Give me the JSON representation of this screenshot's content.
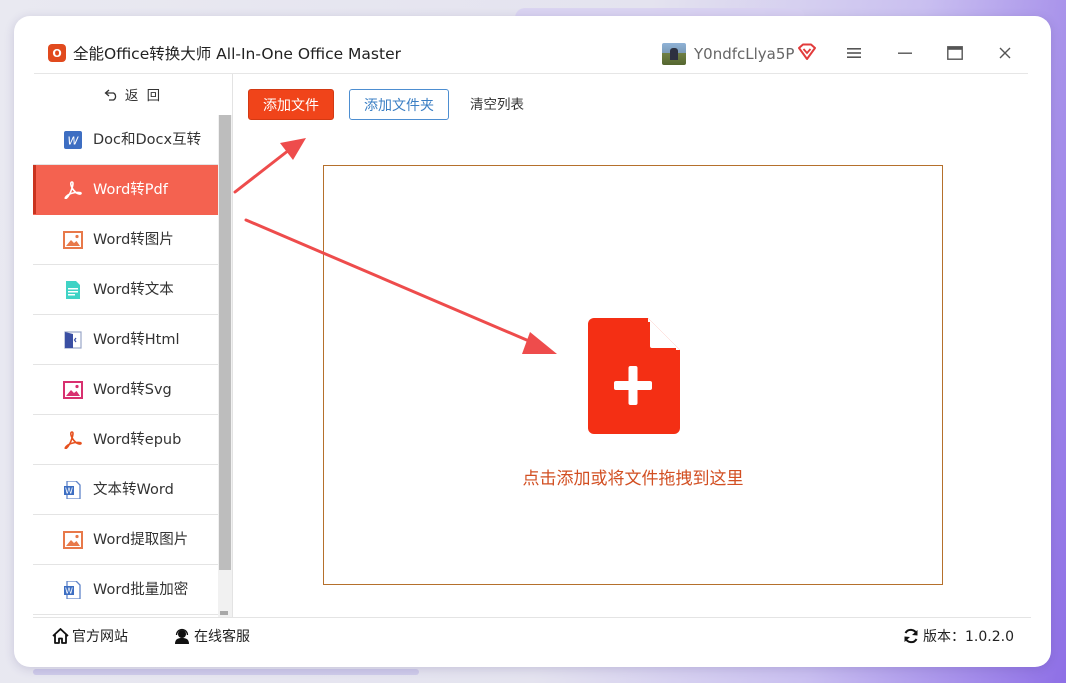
{
  "app": {
    "logo_text": "O",
    "title": "全能Office转换大师 All-In-One Office Master",
    "username": "Y0ndfcLlya5P"
  },
  "colors": {
    "accent": "#f0441a",
    "active_nav": "#f46250",
    "link_blue": "#3b7fc4",
    "dropzone_border": "#b5702c",
    "hint_text": "#d24f22"
  },
  "sidebar": {
    "back_label": "返 回",
    "items": [
      {
        "label": "Doc和Docx互转",
        "icon": "word-doc-icon"
      },
      {
        "label": "Word转Pdf",
        "icon": "pdf-icon",
        "active": true
      },
      {
        "label": "Word转图片",
        "icon": "image-icon"
      },
      {
        "label": "Word转文本",
        "icon": "text-file-icon"
      },
      {
        "label": "Word转Html",
        "icon": "html-icon"
      },
      {
        "label": "Word转Svg",
        "icon": "svg-image-icon"
      },
      {
        "label": "Word转epub",
        "icon": "epub-icon"
      },
      {
        "label": "文本转Word",
        "icon": "word-outline-icon"
      },
      {
        "label": "Word提取图片",
        "icon": "image-extract-icon"
      },
      {
        "label": "Word批量加密",
        "icon": "word-encrypt-icon"
      }
    ]
  },
  "toolbar": {
    "add_file": "添加文件",
    "add_folder": "添加文件夹",
    "clear_list": "清空列表"
  },
  "dropzone": {
    "hint": "点击添加或将文件拖拽到这里",
    "icon": "file-add-icon"
  },
  "footer": {
    "website": "官方网站",
    "service": "在线客服",
    "version": "版本：1.0.2.0"
  }
}
